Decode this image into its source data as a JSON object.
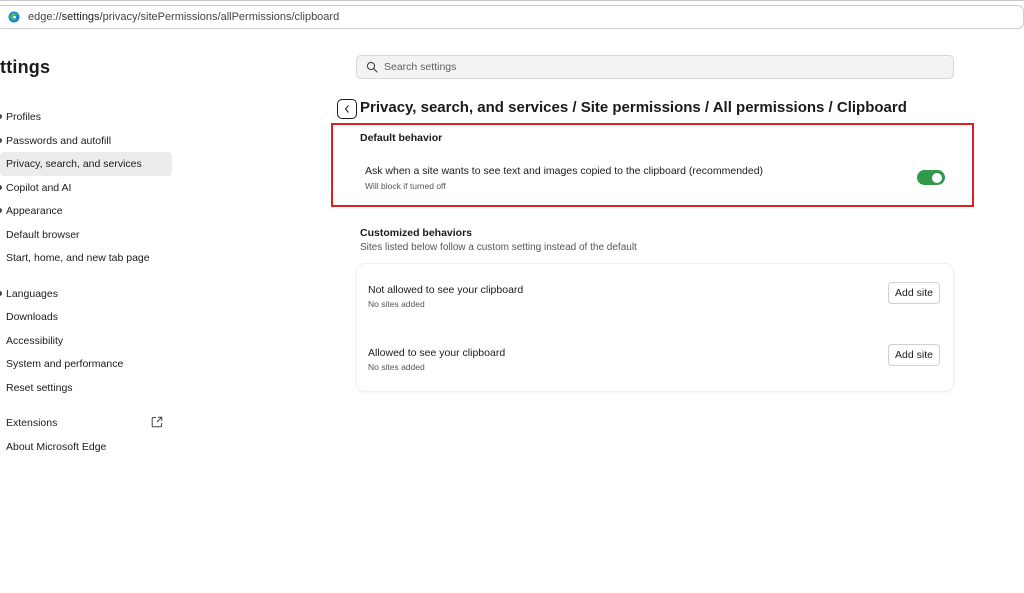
{
  "address_bar": {
    "url_prefix": "edge://",
    "url_host": "settings",
    "url_path": "/privacy/sitePermissions/allPermissions/clipboard"
  },
  "sidebar": {
    "title": "ttings",
    "items": [
      {
        "label": "Profiles"
      },
      {
        "label": "Passwords and autofill"
      },
      {
        "label": "Privacy, search, and services",
        "selected": true
      },
      {
        "label": "Copilot and AI"
      },
      {
        "label": "Appearance"
      },
      {
        "label": "Default browser"
      },
      {
        "label": "Start, home, and new tab page"
      },
      {
        "label": "Languages"
      },
      {
        "label": "Downloads"
      },
      {
        "label": "Accessibility"
      },
      {
        "label": "System and performance"
      },
      {
        "label": "Reset settings"
      },
      {
        "label": "Extensions"
      },
      {
        "label": "About Microsoft Edge"
      }
    ]
  },
  "search": {
    "placeholder": "Search settings",
    "icon": "search-icon"
  },
  "breadcrumb": {
    "text": "Privacy, search, and services / Site permissions / All permissions / Clipboard"
  },
  "default_behavior": {
    "heading": "Default behavior",
    "setting_title": "Ask when a site wants to see text and images copied to the clipboard (recommended)",
    "setting_sub": "Will block if turned off",
    "toggle_on": true,
    "toggle_color": "#2f9a4b",
    "highlight_color": "#e02020"
  },
  "customized_behaviors": {
    "heading": "Customized behaviors",
    "subtitle": "Sites listed below follow a custom setting instead of the default",
    "rows": [
      {
        "title": "Not allowed to see your clipboard",
        "sub": "No sites added",
        "button": "Add site"
      },
      {
        "title": "Allowed to see your clipboard",
        "sub": "No sites added",
        "button": "Add site"
      }
    ]
  }
}
